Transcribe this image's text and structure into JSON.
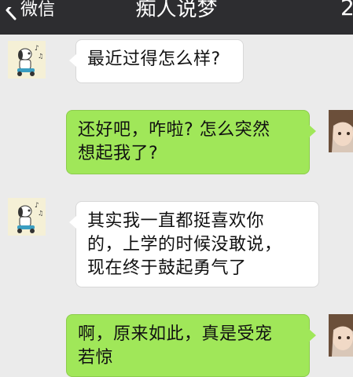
{
  "header": {
    "back_label": "微信",
    "title": "痴人说梦",
    "right_glyph": "2"
  },
  "colors": {
    "nav_bg": "#2d2d30",
    "chat_bg": "#ebebeb",
    "bubble_sent": "#a0e759",
    "bubble_received": "#ffffff"
  },
  "messages": [
    {
      "side": "left",
      "avatar": "snoopy-avatar-icon",
      "text": "最近过得怎么样?"
    },
    {
      "side": "right",
      "avatar": "user-avatar",
      "text": "还好吧，咋啦? 怎么突然\n想起我了?"
    },
    {
      "side": "left",
      "avatar": "snoopy-avatar-icon",
      "text": "其实我一直都挺喜欢你\n的，上学的时候没敢说，\n现在终于鼓起勇气了"
    },
    {
      "side": "right",
      "avatar": "user-avatar",
      "text": "啊，原来如此，真是受宠\n若惊"
    }
  ]
}
